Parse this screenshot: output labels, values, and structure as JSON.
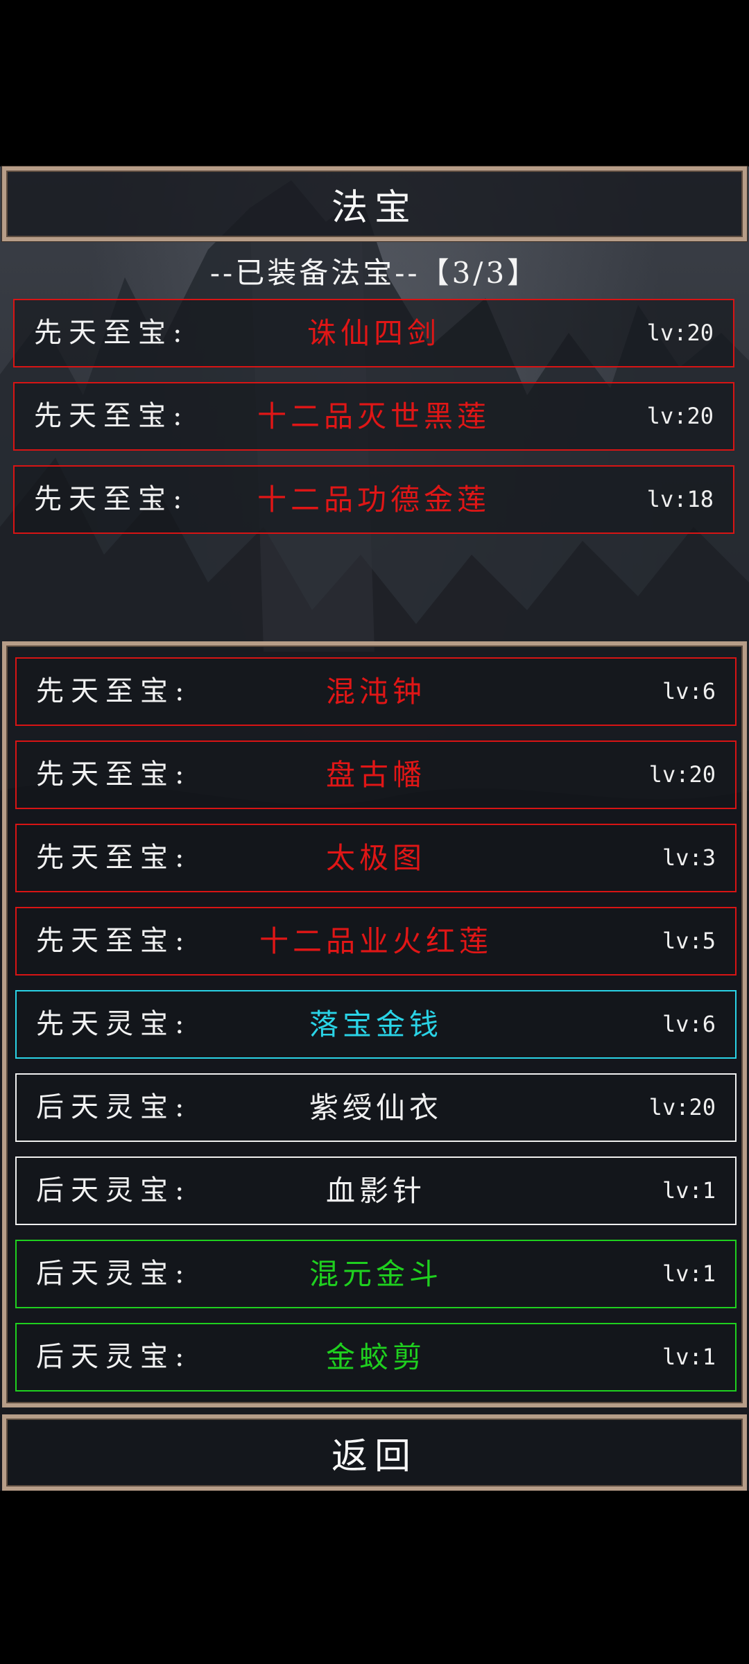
{
  "title": "法宝",
  "equipped": {
    "heading": "--已装备法宝--【3/3】",
    "items": [
      {
        "category": "先天至宝:",
        "name": "诛仙四剑",
        "level": "lv:20",
        "color": "#e01616"
      },
      {
        "category": "先天至宝:",
        "name": "十二品灭世黑莲",
        "level": "lv:20",
        "color": "#e01616"
      },
      {
        "category": "先天至宝:",
        "name": "十二品功德金莲",
        "level": "lv:18",
        "color": "#e01616"
      }
    ]
  },
  "inventory": {
    "items": [
      {
        "category": "先天至宝:",
        "name": "混沌钟",
        "level": "lv:6",
        "color": "#e01616"
      },
      {
        "category": "先天至宝:",
        "name": "盘古幡",
        "level": "lv:20",
        "color": "#e01616"
      },
      {
        "category": "先天至宝:",
        "name": "太极图",
        "level": "lv:3",
        "color": "#e01616"
      },
      {
        "category": "先天至宝:",
        "name": "十二品业火红莲",
        "level": "lv:5",
        "color": "#e01616"
      },
      {
        "category": "先天灵宝:",
        "name": "落宝金钱",
        "level": "lv:6",
        "color": "#2ad3e6"
      },
      {
        "category": "后天灵宝:",
        "name": "紫绶仙衣",
        "level": "lv:20",
        "color": "#f0f0f0"
      },
      {
        "category": "后天灵宝:",
        "name": "血影针",
        "level": "lv:1",
        "color": "#f0f0f0"
      },
      {
        "category": "后天灵宝:",
        "name": "混元金斗",
        "level": "lv:1",
        "color": "#1fd01f"
      },
      {
        "category": "后天灵宝:",
        "name": "金蛟剪",
        "level": "lv:1",
        "color": "#1fd01f"
      }
    ]
  },
  "back_label": "返回"
}
